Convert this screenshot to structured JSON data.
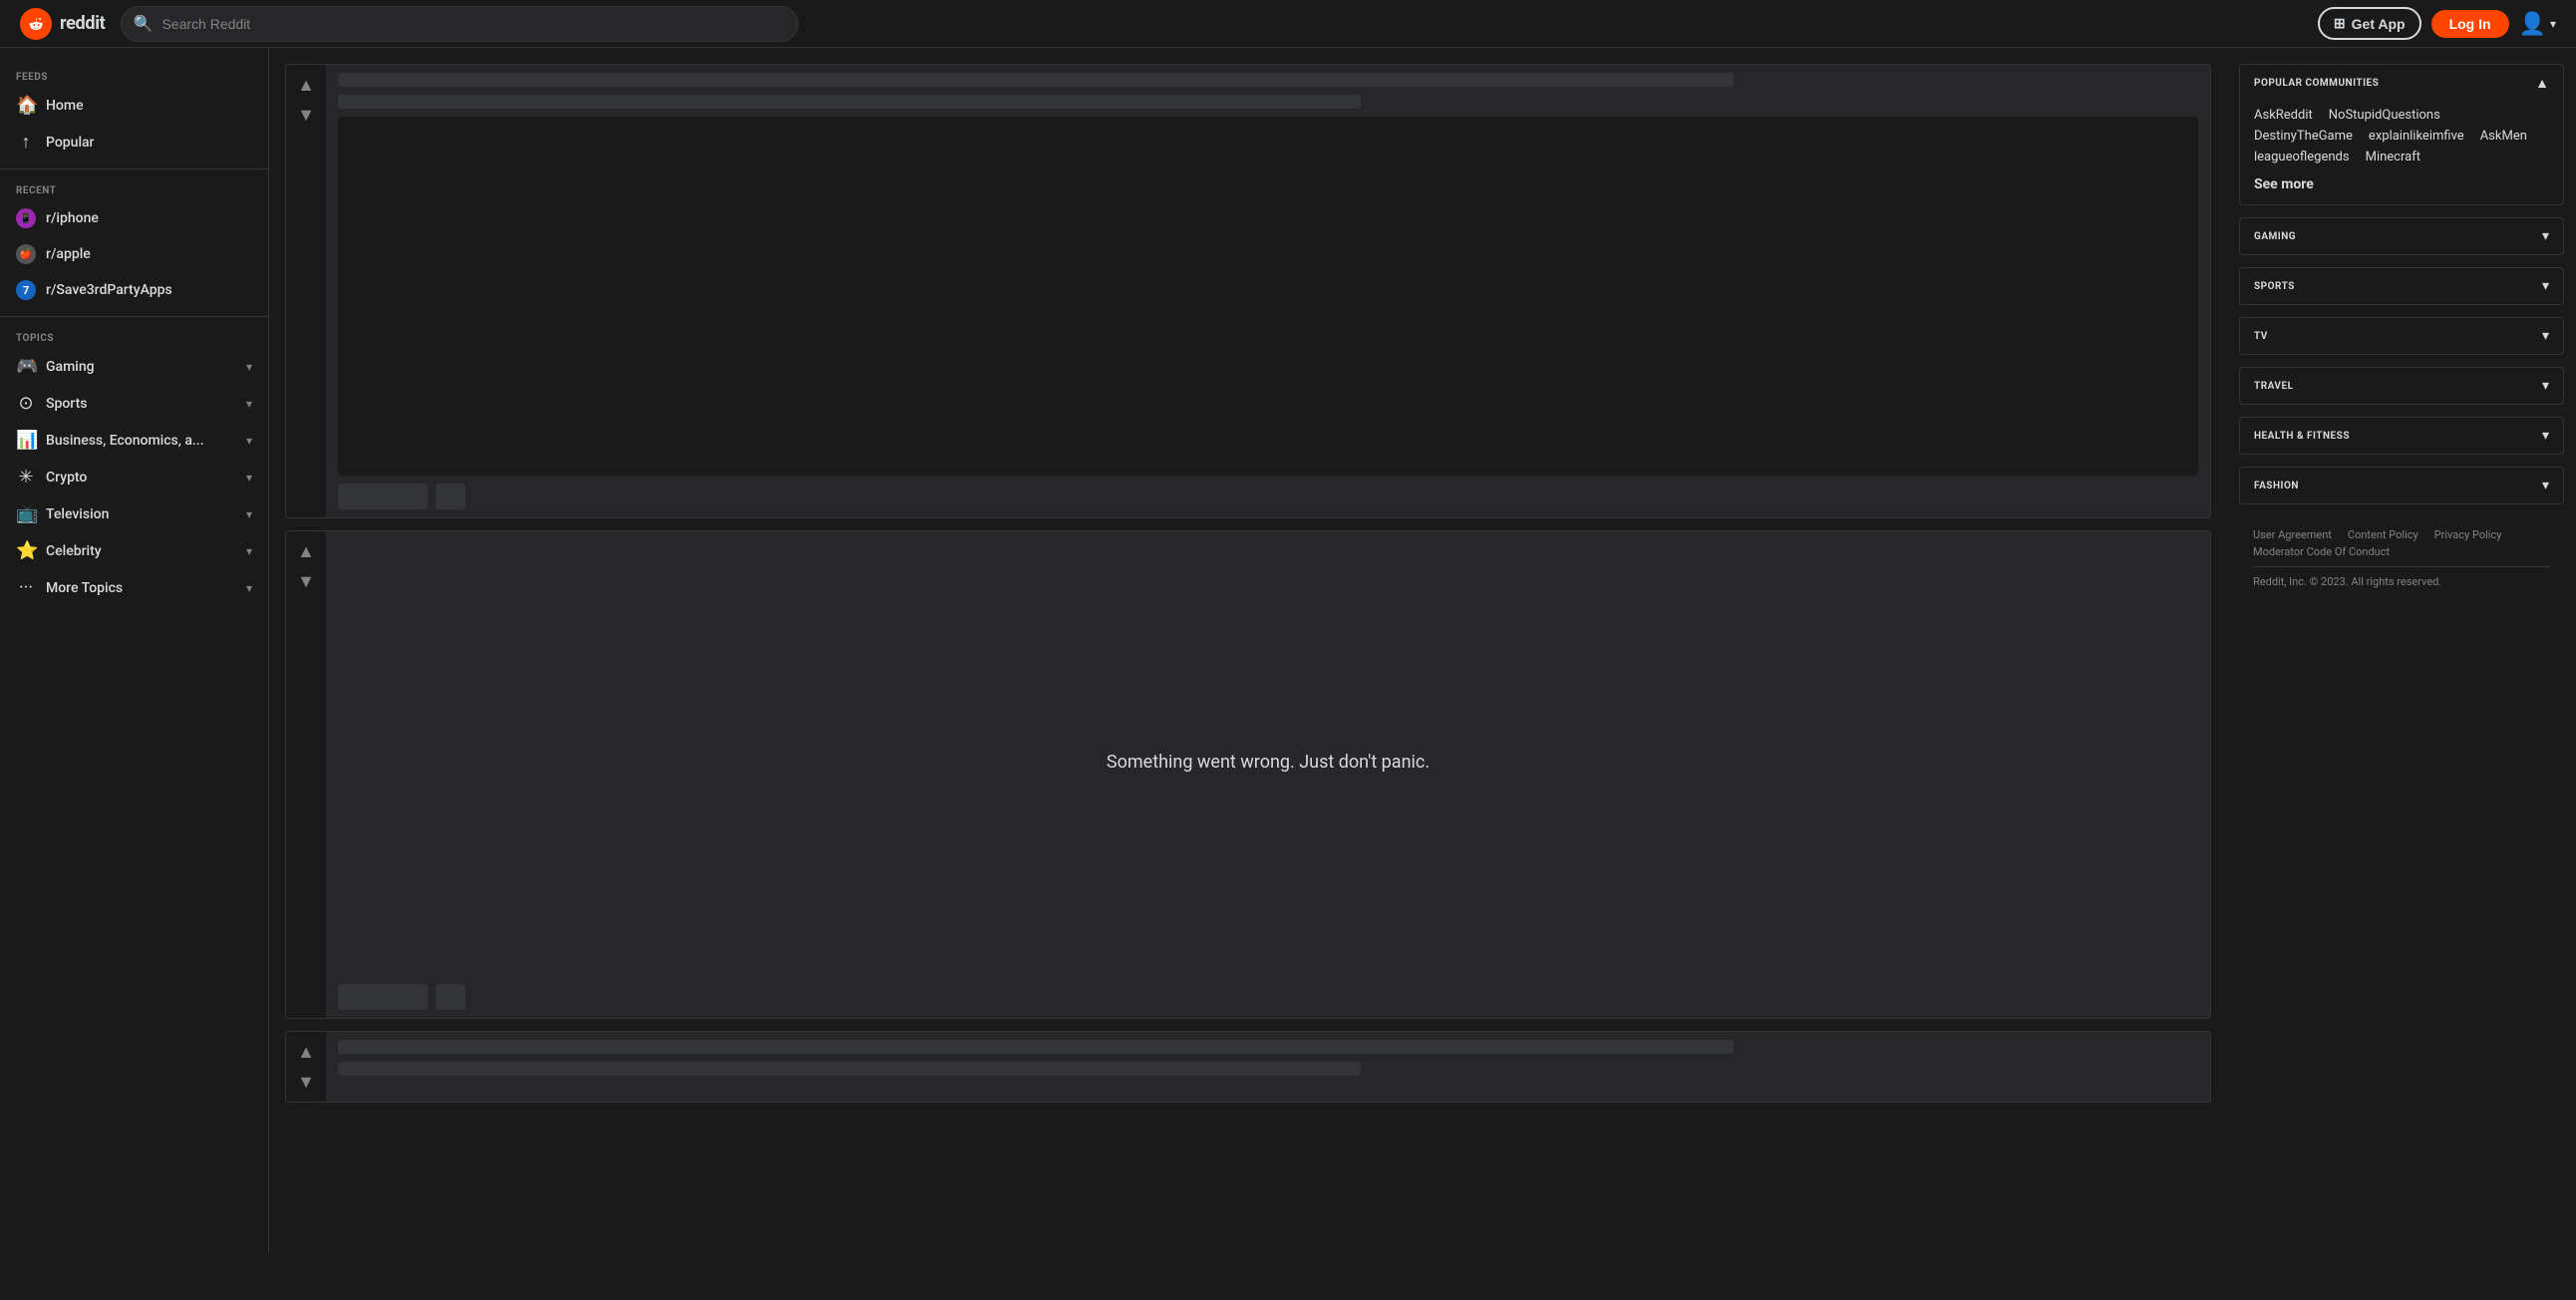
{
  "header": {
    "logo_text": "reddit",
    "search_placeholder": "Search Reddit",
    "get_app_label": "Get App",
    "login_label": "Log In"
  },
  "sidebar_left": {
    "feeds_label": "FEEDS",
    "feeds": [
      {
        "id": "home",
        "label": "Home",
        "icon": "🏠"
      },
      {
        "id": "popular",
        "label": "Popular",
        "icon": "🔼"
      }
    ],
    "recent_label": "RECENT",
    "recent": [
      {
        "id": "iphone",
        "label": "r/iphone",
        "icon_class": "icon-iphone",
        "icon_char": "📱"
      },
      {
        "id": "apple",
        "label": "r/apple",
        "icon_class": "icon-apple",
        "icon_char": "🍎"
      },
      {
        "id": "save3rdparty",
        "label": "r/Save3rdPartyApps",
        "icon_class": "icon-save",
        "icon_char": "7"
      }
    ],
    "topics_label": "TOPICS",
    "topics": [
      {
        "id": "gaming",
        "label": "Gaming",
        "icon": "🎮"
      },
      {
        "id": "sports",
        "label": "Sports",
        "icon": "⭕"
      },
      {
        "id": "business",
        "label": "Business, Economics, a...",
        "icon": "📊"
      },
      {
        "id": "crypto",
        "label": "Crypto",
        "icon": "✳"
      },
      {
        "id": "television",
        "label": "Television",
        "icon": "📺"
      },
      {
        "id": "celebrity",
        "label": "Celebrity",
        "icon": "⭐"
      },
      {
        "id": "more-topics",
        "label": "More Topics",
        "icon": "···"
      }
    ]
  },
  "main": {
    "posts": [
      {
        "id": "post-1",
        "has_error": false,
        "title_long_width": "75%",
        "title_short_width": "50%"
      },
      {
        "id": "post-error",
        "has_error": true,
        "error_message": "Something went wrong. Just don't panic.",
        "title_long_width": "75%",
        "title_short_width": "50%"
      },
      {
        "id": "post-2",
        "has_error": false,
        "title_long_width": "75%",
        "title_short_width": "50%"
      }
    ]
  },
  "sidebar_right": {
    "popular_communities": {
      "title": "POPULAR COMMUNITIES",
      "communities": [
        "AskReddit",
        "NoStupidQuestions",
        "DestinyTheGame",
        "explainlikeimfive",
        "AskMen",
        "leagueoflegends",
        "Minecraft"
      ],
      "see_more_label": "See more"
    },
    "topics": [
      {
        "id": "gaming",
        "label": "GAMING"
      },
      {
        "id": "sports",
        "label": "SPORTS"
      },
      {
        "id": "tv",
        "label": "TV"
      },
      {
        "id": "travel",
        "label": "TRAVEL"
      },
      {
        "id": "health",
        "label": "HEALTH & FITNESS"
      },
      {
        "id": "fashion",
        "label": "FASHION"
      }
    ],
    "footer": {
      "links": [
        "User Agreement",
        "Content Policy",
        "Privacy Policy",
        "Moderator Code Of Conduct"
      ],
      "copyright": "Reddit, Inc. © 2023. All rights reserved."
    }
  }
}
